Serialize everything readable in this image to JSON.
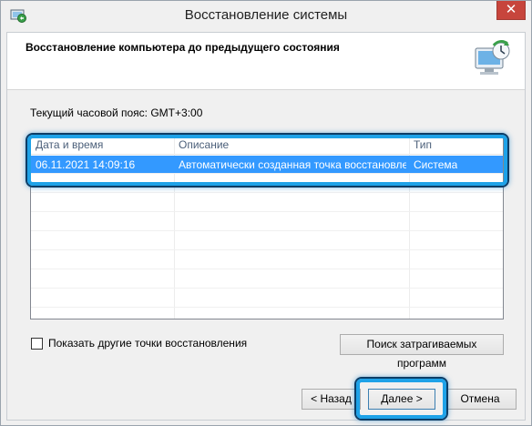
{
  "window": {
    "title": "Восстановление системы",
    "close_glyph": "✕"
  },
  "header": {
    "title": "Восстановление компьютера до предыдущего состояния"
  },
  "timezone_label": "Текущий часовой пояс: GMT+3:00",
  "table": {
    "columns": [
      "Дата и время",
      "Описание",
      "Тип"
    ],
    "rows": [
      {
        "date": "06.11.2021 14:09:16",
        "description": "Автоматически созданная точка восстановле...",
        "type": "Система"
      }
    ]
  },
  "show_more_label": "Показать другие точки восстановления",
  "scan_button": "Поиск затрагиваемых программ",
  "buttons": {
    "back": "< Назад",
    "next": "Далее >",
    "cancel": "Отмена"
  },
  "colors": {
    "selection": "#3399ff",
    "highlight": "#1ea2e8",
    "close": "#c7453c"
  },
  "icons": [
    "restore-app-icon",
    "system-restore-art",
    "close-icon",
    "checkbox-icon"
  ]
}
